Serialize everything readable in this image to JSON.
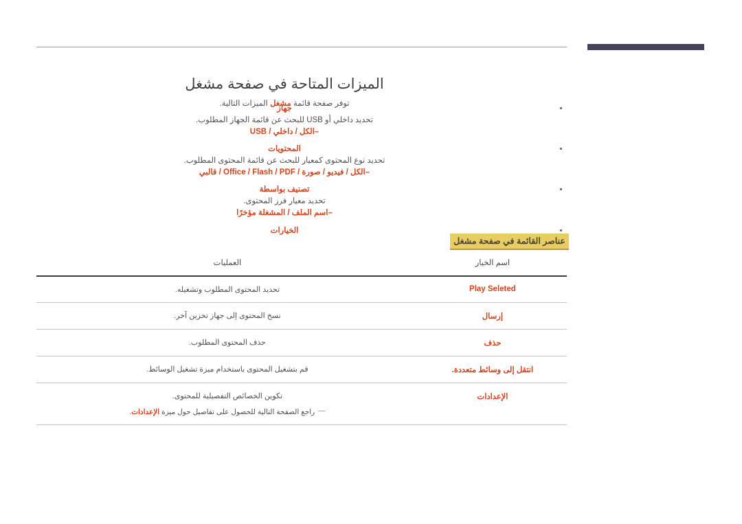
{
  "header": {
    "rule_color": "#9a9a9a",
    "bar_color": "#464258"
  },
  "page": {
    "title": "الميزات المتاحة في صفحة مشغل",
    "intro_before": "توفر صفحة قائمة ",
    "intro_accent": "مشغل",
    "intro_after": " الميزات التالية."
  },
  "bullets": [
    {
      "head": "جهاز",
      "desc": "تحديد داخلي أو USB للبحث عن قائمة الجهاز المطلوب.",
      "options": "–الكل / داخلي / USB"
    },
    {
      "head": "المحتويات",
      "desc": "تحديد نوع المحتوى كمعيار للبحث عن قائمة المحتوى المطلوب.",
      "options": "–الكل / فيديو / صورة / Office / Flash / PDF / قالبي"
    },
    {
      "head": "تصنيف بواسطة",
      "desc": "تحديد معيار فرز المحتوى.",
      "options": "–اسم الملف / المشغلة مؤخرًا"
    },
    {
      "head": "الخيارات",
      "desc": "",
      "options": ""
    }
  ],
  "section": {
    "label": "عناصر القائمة في صفحة مشغل",
    "background": "#e8cd63",
    "underline": "#b89a2e"
  },
  "table": {
    "headers": {
      "name": "اسم الخيار",
      "operations": "العمليات"
    },
    "rows": [
      {
        "name": "Play Seleted",
        "operations": "تحديد المحتوى المطلوب وتشغيله.",
        "note_dash": "",
        "note_before": "",
        "note_accent": "",
        "note_after": ""
      },
      {
        "name": "إرسال",
        "operations": "نسخ المحتوى إلى جهاز تخزين آخر.",
        "note_dash": "",
        "note_before": "",
        "note_accent": "",
        "note_after": ""
      },
      {
        "name": "حذف",
        "operations": "حذف المحتوى المطلوب.",
        "note_dash": "",
        "note_before": "",
        "note_accent": "",
        "note_after": ""
      },
      {
        "name": "انتقل إلى وسائط متعددة.",
        "operations": "قم بتشغيل المحتوى باستخدام ميزة تشغيل الوسائط.",
        "note_dash": "",
        "note_before": "",
        "note_accent": "",
        "note_after": ""
      },
      {
        "name": "الإعدادات",
        "operations": "تكوين الخصائص التفصيلية للمحتوى.",
        "note_dash": "—",
        "note_before": " راجع الصفحة التالية للحصول على تفاصيل حول ميزة ",
        "note_accent": "الإعدادات",
        "note_after": "."
      }
    ]
  }
}
